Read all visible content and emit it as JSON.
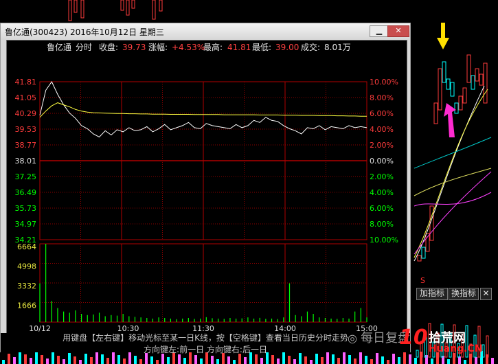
{
  "window": {
    "title": "鲁亿通(300423) 2016年10月12日 星期三",
    "minimize_label": "▁",
    "close_label": "✕"
  },
  "header": {
    "name": "鲁亿通",
    "mode": "分时",
    "close_label": "收盘:",
    "close_value": "39.73",
    "change_label": "涨幅:",
    "change_value": "+4.53%",
    "high_label": "最高:",
    "high_value": "41.81",
    "low_label": "最低:",
    "low_value": "39.00",
    "volume_label": "成交:",
    "volume_value": "8.01万"
  },
  "chart_data": {
    "type": "line",
    "price_ticks": [
      "41.81",
      "41.05",
      "40.29",
      "39.53",
      "38.77",
      "38.01",
      "37.25",
      "36.49",
      "35.73",
      "34.97",
      "34.21"
    ],
    "pct_ticks": [
      "10.00%",
      "8.00%",
      "6.00%",
      "4.00%",
      "2.00%",
      "0.00%",
      "2.00%",
      "4.00%",
      "6.00%",
      "8.00%",
      "10.00%"
    ],
    "volume_ticks": [
      "6664",
      "4998",
      "3332",
      "1666"
    ],
    "time_ticks": [
      "10/12",
      "10:30",
      "11:30",
      "14:00",
      "15:00"
    ],
    "ylim": [
      34.21,
      41.81
    ],
    "vol_max": 6664,
    "series": [
      {
        "values": [
          40.2,
          41.4,
          41.81,
          41.2,
          40.7,
          40.3,
          40.05,
          39.7,
          39.55,
          39.3,
          39.15,
          39.45,
          39.25,
          39.5,
          39.4,
          39.6,
          39.45,
          39.5,
          39.65,
          39.4,
          39.55,
          39.75,
          39.5,
          39.6,
          39.7,
          39.85,
          39.6,
          39.55,
          39.8,
          39.7,
          39.65,
          39.6,
          39.55,
          39.75,
          39.6,
          39.7,
          39.95,
          39.85,
          40.1,
          39.95,
          39.9,
          39.7,
          39.55,
          39.45,
          39.3,
          39.6,
          39.55,
          39.7,
          39.5,
          39.65,
          39.6,
          39.55,
          39.7,
          39.6,
          39.65,
          39.6
        ]
      },
      {
        "values": [
          40.1,
          40.4,
          40.65,
          40.8,
          40.7,
          40.6,
          40.48,
          40.4,
          40.35,
          40.32,
          40.31,
          40.3,
          40.29,
          40.28,
          40.28,
          40.27,
          40.27,
          40.26,
          40.26,
          40.25,
          40.25,
          40.25,
          40.24,
          40.24,
          40.24,
          40.24,
          40.23,
          40.23,
          40.23,
          40.23,
          40.23,
          40.22,
          40.22,
          40.22,
          40.22,
          40.22,
          40.22,
          40.21,
          40.21,
          40.21,
          40.21,
          40.2,
          40.2,
          40.2,
          40.19,
          40.19,
          40.19,
          40.18,
          40.18,
          40.18,
          40.17,
          40.17,
          40.16,
          40.16,
          40.15,
          40.15
        ]
      }
    ],
    "volume": [
      3300,
      6664,
      1800,
      1200,
      900,
      800,
      1000,
      700,
      600,
      650,
      800,
      500,
      600,
      550,
      700,
      500,
      450,
      400,
      350,
      300,
      400,
      350,
      300,
      250,
      300,
      350,
      280,
      300,
      420,
      330,
      300,
      280,
      350,
      300,
      320,
      400,
      300,
      360,
      280,
      300,
      260,
      400,
      3300,
      600,
      500,
      900,
      700,
      400,
      350,
      300,
      280,
      350,
      300,
      900,
      1200,
      400
    ]
  },
  "footer": {
    "hint_line1": "用键盘【左右键】移动光标至某一日K线，按【空格键】查看当日历史分时走势",
    "hint_line2": "方向键左:前一日   方向键右:后一日"
  },
  "right_panel": {
    "add_indicator": "加指标",
    "swap_indicator": "换指标",
    "close_label": "✕"
  },
  "watermark": {
    "text": "每日复盘",
    "brand_num": "10",
    "brand_text": "拾荒网",
    "site": "Huang.CN"
  },
  "colors": {
    "up": "#ff3c3c",
    "down": "#00ffff",
    "price_line": "#ffffff",
    "avg_line": "#ffff40",
    "volume": "#00ff00",
    "grid": "#8b0000",
    "arrow_yellow": "#ffe000",
    "arrow_magenta": "#ff2bd0"
  }
}
